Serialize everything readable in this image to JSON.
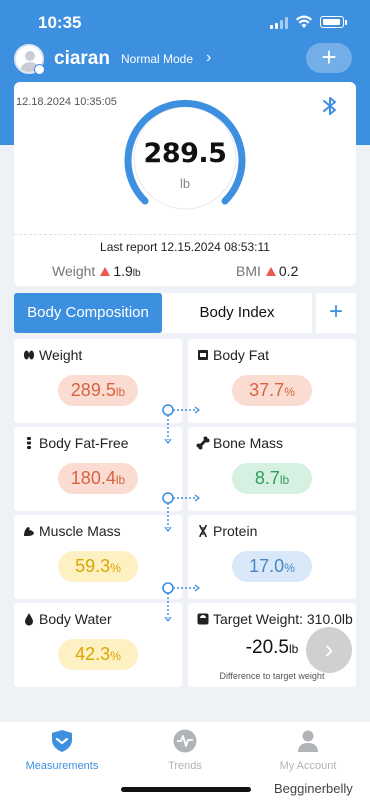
{
  "status_bar": {
    "time": "10:35"
  },
  "header": {
    "user_name": "ciaran",
    "mode_label": "Normal Mode",
    "add_label": "+"
  },
  "measurement": {
    "timestamp": "12.18.2024 10:35:05",
    "weight_value": "289.5",
    "weight_unit": "lb",
    "last_report": "Last report 12.15.2024 08:53:11",
    "delta_weight_label": "Weight",
    "delta_weight_value": "1.9",
    "delta_weight_unit": "lb",
    "delta_bmi_label": "BMI",
    "delta_bmi_value": "0.2"
  },
  "tabs": [
    {
      "label": "Body Composition",
      "active": true
    },
    {
      "label": "Body Index",
      "active": false
    }
  ],
  "tab_add_label": "+",
  "metrics": {
    "weight": {
      "label": "Weight",
      "value": "289.5",
      "unit": "lb",
      "icon": "footprint-icon"
    },
    "body_fat": {
      "label": "Body Fat",
      "value": "37.7",
      "unit": "%",
      "icon": "fat-icon"
    },
    "fat_free": {
      "label": "Body Fat-Free",
      "value": "180.4",
      "unit": "lb",
      "icon": "spine-icon"
    },
    "bone_mass": {
      "label": "Bone Mass",
      "value": "8.7",
      "unit": "lb",
      "icon": "bone-icon"
    },
    "muscle": {
      "label": "Muscle Mass",
      "value": "59.3",
      "unit": "%",
      "icon": "muscle-icon"
    },
    "protein": {
      "label": "Protein",
      "value": "17.0",
      "unit": "%",
      "icon": "dna-icon"
    },
    "water": {
      "label": "Body Water",
      "value": "42.3",
      "unit": "%",
      "icon": "water-drop-icon"
    },
    "target": {
      "label": "Target Weight: 310.0lb",
      "value": "-20.5",
      "unit": "lb",
      "caption": "Difference to target weight",
      "icon": "scale-icon"
    }
  },
  "nav": [
    {
      "label": "Measurements",
      "active": true,
      "icon": "shield-icon"
    },
    {
      "label": "Trends",
      "active": false,
      "icon": "heartbeat-icon"
    },
    {
      "label": "My Account",
      "active": false,
      "icon": "person-icon"
    }
  ],
  "watermark": "Begginerbelly",
  "colors": {
    "brand_blue": "#3d8fe0",
    "pill_orange": "#fbdcd2",
    "pill_green": "#d6f1e2",
    "pill_yellow": "#fdf0c2",
    "pill_blue": "#d9e8f8",
    "increase_red": "#e85a4f"
  }
}
